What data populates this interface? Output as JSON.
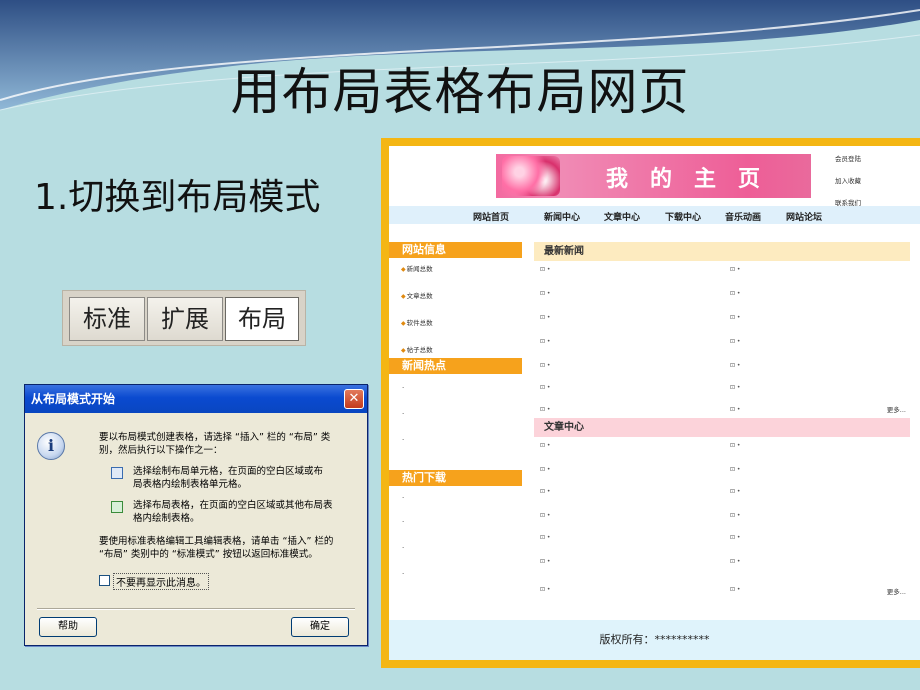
{
  "slide": {
    "title": "用布局表格布局网页",
    "subtitle": "1.切换到布局模式"
  },
  "modebar": {
    "buttons": [
      "标准",
      "扩展",
      "布局"
    ],
    "active": "布局"
  },
  "dialog": {
    "title": "从布局模式开始",
    "close": "✕",
    "intro": [
      "要以布局模式创建表格，请选择 “插入” 栏的 “布局” 类",
      "别，然后执行以下操作之一："
    ],
    "option1": [
      "选择绘制布局单元格，在页面的空白区域或布",
      "局表格内绘制表格单元格。"
    ],
    "option2": [
      "选择布局表格，在页面的空白区域或其他布局表",
      "格内绘制表格。"
    ],
    "outro": [
      "要使用标准表格编辑工具编辑表格，请单击 “插入” 栏的",
      "“布局” 类别中的 “标准模式” 按钮以返回标准模式。"
    ],
    "checkbox_label": "不要再显示此消息。",
    "help_button": "帮助",
    "ok_button": "确定"
  },
  "webpage": {
    "banner_text": "我的主页",
    "top_links": [
      "会员登陆",
      "加入收藏",
      "联系我们"
    ],
    "nav": [
      "网站首页",
      "新闻中心",
      "文章中心",
      "下载中心",
      "音乐动画",
      "网站论坛"
    ],
    "site_info": {
      "heading": "网站信息",
      "items": [
        "新闻总数",
        "文章总数",
        "软件总数",
        "帖子总数"
      ]
    },
    "news_hot": {
      "heading": "新闻热点",
      "dots": [
        ".",
        ".",
        "."
      ]
    },
    "hot_download": {
      "heading": "热门下载",
      "dots": [
        ".",
        ".",
        ".",
        "."
      ]
    },
    "latest_news": {
      "heading": "最新新闻",
      "more": "更多..."
    },
    "article_center": {
      "heading": "文章中心",
      "more": "更多..."
    },
    "footer": "版权所有：**********"
  }
}
